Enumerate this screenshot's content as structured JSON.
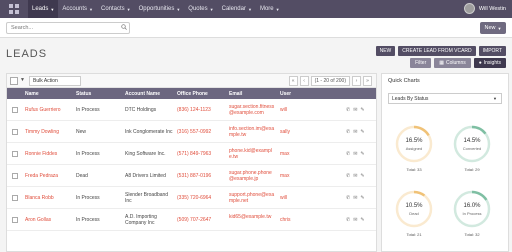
{
  "nav": {
    "items": [
      {
        "label": "Leads",
        "active": true
      },
      {
        "label": "Accounts",
        "active": false
      },
      {
        "label": "Contacts",
        "active": false
      },
      {
        "label": "Opportunities",
        "active": false
      },
      {
        "label": "Quotes",
        "active": false
      },
      {
        "label": "Calendar",
        "active": false
      },
      {
        "label": "More",
        "active": false
      }
    ],
    "user_name": "Will Westin"
  },
  "search": {
    "placeholder": "Search..."
  },
  "new_button": "New",
  "page_title": "LEADS",
  "actions": {
    "new": "NEW",
    "create_vcard": "CREATE LEAD FROM VCARD",
    "import": "IMPORT",
    "filter": "Filter",
    "columns": "Columns",
    "insights": "Insights"
  },
  "toolbar": {
    "bulk_action": "Bulk Action",
    "page_count": "(1 - 20 of 200)"
  },
  "table": {
    "headers": [
      "Name",
      "Status",
      "Account Name",
      "Office Phone",
      "Email",
      "User"
    ],
    "rows": [
      {
        "name": "Rufus Guerriero",
        "status": "In Process",
        "account": "DTC Holdings",
        "phone": "(836) 124-1123",
        "email": "sugar.section.fitness@example.com",
        "user": "will"
      },
      {
        "name": "Timmy Dowling",
        "status": "New",
        "account": "Ink Conglomerate Inc",
        "phone": "(316) 557-0992",
        "email": "info.section.im@example.tw",
        "user": "sally"
      },
      {
        "name": "Ronnie Fiddes",
        "status": "In Process",
        "account": "King Software Inc.",
        "phone": "(571) 849-7963",
        "email": "phone.kid@example.tw",
        "user": "max"
      },
      {
        "name": "Freda Pedraza",
        "status": "Dead",
        "account": "A8 Drivers Limited",
        "phone": "(531) 887-0196",
        "email": "sugar.phone.phone@example.jp",
        "user": "max"
      },
      {
        "name": "Blanca Robb",
        "status": "In Process",
        "account": "Slender Broadband Inc",
        "phone": "(335) 720-6964",
        "email": "support.phone@example.net",
        "user": "will"
      },
      {
        "name": "Aron Gollas",
        "status": "In Process",
        "account": "A.D. Importing Company Inc",
        "phone": "(509) 707-2647",
        "email": "kid65@example.tw",
        "user": "chris"
      }
    ]
  },
  "quick_charts": {
    "title": "Quick Charts",
    "selector": "Leads By Status",
    "items": [
      {
        "pct": "16.5%",
        "label": "Assigned",
        "total": "Total: 33",
        "fraction": 0.165,
        "color": "#f0c277"
      },
      {
        "pct": "14.5%",
        "label": "Converted",
        "total": "Total: 29",
        "fraction": 0.145,
        "color": "#7fbfa3"
      },
      {
        "pct": "10.5%",
        "label": "Dead",
        "total": "Total: 21",
        "fraction": 0.105,
        "color": "#f0c277"
      },
      {
        "pct": "16.0%",
        "label": "In Process",
        "total": "Total: 32",
        "fraction": 0.16,
        "color": "#7fbfa3"
      }
    ]
  }
}
